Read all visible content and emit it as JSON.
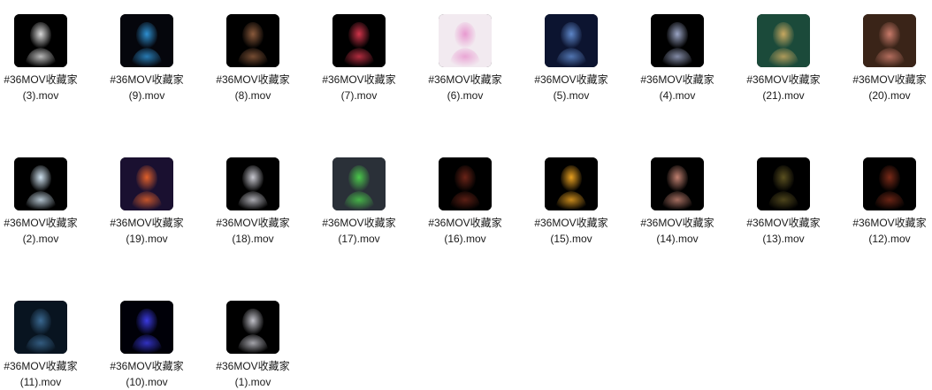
{
  "files": [
    {
      "line1": "#36MOV收藏家",
      "line2": "(3).mov",
      "icon": "video-thumbnail-icon"
    },
    {
      "line1": "#36MOV收藏家",
      "line2": "(9).mov",
      "icon": "video-thumbnail-icon"
    },
    {
      "line1": "#36MOV收藏家",
      "line2": "(8).mov",
      "icon": "video-thumbnail-icon"
    },
    {
      "line1": "#36MOV收藏家",
      "line2": "(7).mov",
      "icon": "video-thumbnail-icon"
    },
    {
      "line1": "#36MOV收藏家",
      "line2": "(6).mov",
      "icon": "video-thumbnail-icon"
    },
    {
      "line1": "#36MOV收藏家",
      "line2": "(5).mov",
      "icon": "video-thumbnail-icon"
    },
    {
      "line1": "#36MOV收藏家",
      "line2": "(4).mov",
      "icon": "video-thumbnail-icon"
    },
    {
      "line1": "#36MOV收藏家",
      "line2": "(21).mov",
      "icon": "video-thumbnail-icon"
    },
    {
      "line1": "#36MOV收藏家",
      "line2": "(20).mov",
      "icon": "video-thumbnail-icon"
    },
    {
      "line1": "#36MOV收藏家",
      "line2": "(2).mov",
      "icon": "video-thumbnail-icon"
    },
    {
      "line1": "#36MOV收藏家",
      "line2": "(19).mov",
      "icon": "video-thumbnail-icon"
    },
    {
      "line1": "#36MOV收藏家",
      "line2": "(18).mov",
      "icon": "video-thumbnail-icon"
    },
    {
      "line1": "#36MOV收藏家",
      "line2": "(17).mov",
      "icon": "video-thumbnail-icon"
    },
    {
      "line1": "#36MOV收藏家",
      "line2": "(16).mov",
      "icon": "video-thumbnail-icon"
    },
    {
      "line1": "#36MOV收藏家",
      "line2": "(15).mov",
      "icon": "video-thumbnail-icon"
    },
    {
      "line1": "#36MOV收藏家",
      "line2": "(14).mov",
      "icon": "video-thumbnail-icon"
    },
    {
      "line1": "#36MOV收藏家",
      "line2": "(13).mov",
      "icon": "video-thumbnail-icon"
    },
    {
      "line1": "#36MOV收藏家",
      "line2": "(12).mov",
      "icon": "video-thumbnail-icon"
    },
    {
      "line1": "#36MOV收藏家",
      "line2": "(11).mov",
      "icon": "video-thumbnail-icon"
    },
    {
      "line1": "#36MOV收藏家",
      "line2": "(10).mov",
      "icon": "video-thumbnail-icon"
    },
    {
      "line1": "#36MOV收藏家",
      "line2": "(1).mov",
      "icon": "video-thumbnail-icon"
    }
  ],
  "thumb_colors": [
    [
      "#000000",
      "#d9d9d9"
    ],
    [
      "#05060c",
      "#2e8fd0"
    ],
    [
      "#000000",
      "#8a5a3c"
    ],
    [
      "#000000",
      "#d0344a"
    ],
    [
      "#f2eaf0",
      "#e89ad0"
    ],
    [
      "#0c1430",
      "#5d86c8"
    ],
    [
      "#000000",
      "#9aa4c4"
    ],
    [
      "#1b4a3a",
      "#c8a860"
    ],
    [
      "#3a2418",
      "#c87a6a"
    ],
    [
      "#000000",
      "#cfe2f0"
    ],
    [
      "#1a1030",
      "#e0602a"
    ],
    [
      "#000000",
      "#c8c8d0"
    ],
    [
      "#2a3038",
      "#4ac84a"
    ],
    [
      "#000000",
      "#6a2418"
    ],
    [
      "#000000",
      "#e8a020"
    ],
    [
      "#000000",
      "#c08070"
    ],
    [
      "#000000",
      "#5a5020"
    ],
    [
      "#000000",
      "#7a2a18"
    ],
    [
      "#081420",
      "#3a6890"
    ],
    [
      "#000008",
      "#3a3ae0"
    ],
    [
      "#000000",
      "#c0c0c8"
    ]
  ]
}
